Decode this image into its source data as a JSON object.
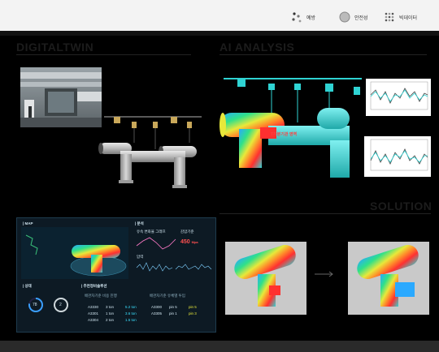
{
  "legend": {
    "items": [
      {
        "label": "예방",
        "icon": "dot-cluster-icon"
      },
      {
        "label": "안전성",
        "icon": "circle-icon"
      },
      {
        "label": "빅데이터",
        "icon": "dot-grid-icon"
      }
    ]
  },
  "sections": {
    "digital_twin": "DIGITALTWIN",
    "ai_analysis": "AI ANALYSIS",
    "solution": "SOLUTION"
  },
  "ai": {
    "hotspot_label": "T자분기관 영역"
  },
  "dashboard": {
    "map_title": "| MAP",
    "analysis_title": "| 분석",
    "analysis_small1": "유속 변화율 그래프",
    "analysis_small2": "압력",
    "pressure_label": "감압기준",
    "pressure_value": "450",
    "pressure_unit": "Mpa",
    "status_title": "| 상태",
    "gauge1": "78",
    "gauge2": "2",
    "rec_title": "| 추천정비솔루션",
    "table_left_header": "배관차기준 비용 진행",
    "table_right_header": "배관차기준 유체별 투입",
    "rows_left": [
      {
        "id": "A3330",
        "a": "3 ton",
        "b": "5.2 ton"
      },
      {
        "id": "A3301",
        "a": "1 ton",
        "b": "3.6 ton"
      },
      {
        "id": "A3304",
        "a": "2 ton",
        "b": "1.5 ton"
      }
    ],
    "rows_right": [
      {
        "id": "A3300",
        "a": "pin 5",
        "b": "pin 5"
      },
      {
        "id": "A3305",
        "a": "pin 1",
        "b": "pin 3"
      }
    ]
  },
  "colors": {
    "accent_cyan": "#2fd3d3",
    "alert_red": "#ff4040",
    "panel_bg": "#0d1a24"
  }
}
